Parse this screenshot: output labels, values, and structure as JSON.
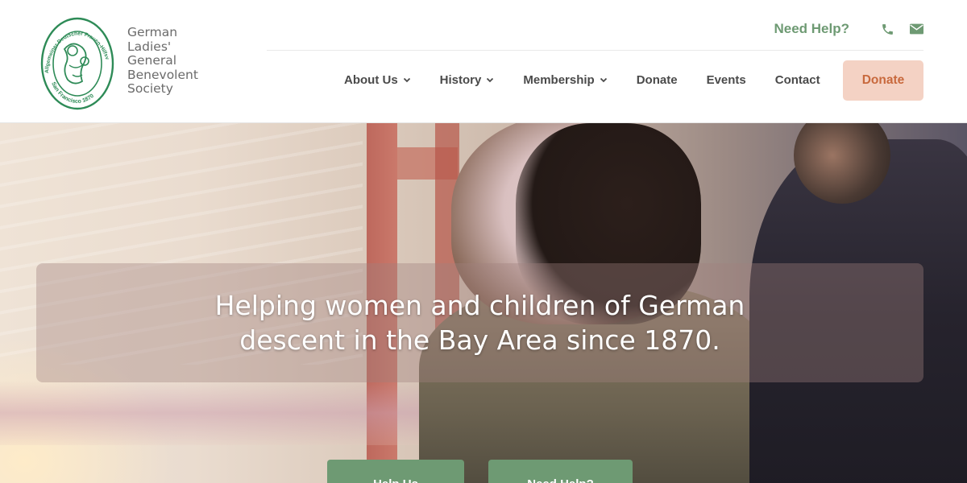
{
  "header": {
    "logo": {
      "seal_text_top": "Allgemeiner Deutscher Frauen-Hilfsverein",
      "seal_text_bottom": "San Francisco 1870",
      "name_lines": [
        "German",
        "Ladies'",
        "General",
        "Benevolent",
        "Society"
      ]
    },
    "utility": {
      "need_help": "Need Help?",
      "phone_icon": "phone-icon",
      "email_icon": "envelope-icon"
    },
    "nav": {
      "about": "About Us",
      "history": "History",
      "membership": "Membership",
      "donate": "Donate",
      "events": "Events",
      "contact": "Contact"
    },
    "donate_button": "Donate"
  },
  "hero": {
    "headline": "Helping women and children of German descent in the Bay Area since 1870.",
    "buttons": {
      "help": "Help Us",
      "need": "Need Help?"
    }
  },
  "colors": {
    "green": "#6e9a73",
    "donate_bg": "#f4d2c4",
    "donate_text": "#c8693d",
    "nav_text": "#4a4a4a",
    "logo_green": "#2e8b57"
  }
}
